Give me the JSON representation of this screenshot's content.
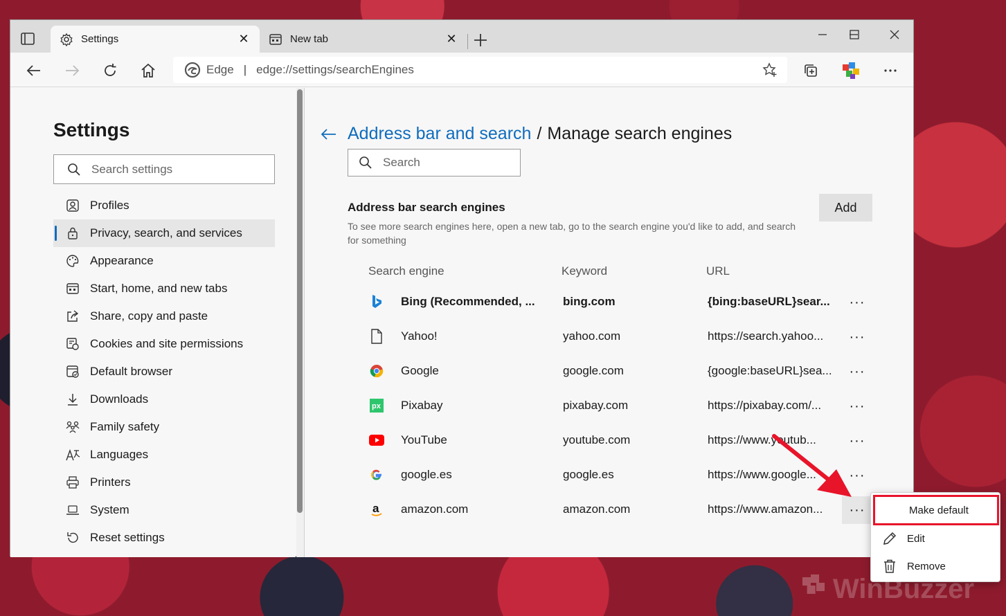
{
  "browser": {
    "tabs": [
      {
        "title": "Settings",
        "icon": "gear-icon"
      },
      {
        "title": "New tab",
        "icon": "newtab-icon"
      }
    ],
    "address": {
      "origin": "Edge",
      "separator": "|",
      "url": "edge://settings/searchEngines"
    }
  },
  "sidebar": {
    "title": "Settings",
    "search_placeholder": "Search settings",
    "items": [
      {
        "label": "Profiles",
        "icon": "profile-icon"
      },
      {
        "label": "Privacy, search, and services",
        "icon": "lock-icon",
        "selected": true
      },
      {
        "label": "Appearance",
        "icon": "palette-icon"
      },
      {
        "label": "Start, home, and new tabs",
        "icon": "start-icon"
      },
      {
        "label": "Share, copy and paste",
        "icon": "share-icon"
      },
      {
        "label": "Cookies and site permissions",
        "icon": "cookies-icon"
      },
      {
        "label": "Default browser",
        "icon": "browser-icon"
      },
      {
        "label": "Downloads",
        "icon": "download-icon"
      },
      {
        "label": "Family safety",
        "icon": "family-icon"
      },
      {
        "label": "Languages",
        "icon": "languages-icon"
      },
      {
        "label": "Printers",
        "icon": "printer-icon"
      },
      {
        "label": "System",
        "icon": "laptop-icon"
      },
      {
        "label": "Reset settings",
        "icon": "reset-icon"
      }
    ]
  },
  "main": {
    "breadcrumb_link": "Address bar and search",
    "breadcrumb_sep": "/",
    "breadcrumb_current": "Manage search engines",
    "search_placeholder": "Search",
    "section_title": "Address bar search engines",
    "section_desc": "To see more search engines here, open a new tab, go to the search engine you'd like to add, and search for something",
    "add_label": "Add",
    "columns": {
      "engine": "Search engine",
      "keyword": "Keyword",
      "url": "URL"
    },
    "engines": [
      {
        "name": "Bing (Recommended, ...",
        "keyword": "bing.com",
        "url": "{bing:baseURL}sear...",
        "icon": "bing-icon",
        "default": true
      },
      {
        "name": "Yahoo!",
        "keyword": "yahoo.com",
        "url": "https://search.yahoo...",
        "icon": "page-icon"
      },
      {
        "name": "Google",
        "keyword": "google.com",
        "url": "{google:baseURL}sea...",
        "icon": "chrome-icon"
      },
      {
        "name": "Pixabay",
        "keyword": "pixabay.com",
        "url": "https://pixabay.com/...",
        "icon": "pixabay-icon"
      },
      {
        "name": "YouTube",
        "keyword": "youtube.com",
        "url": "https://www.youtub...",
        "icon": "youtube-icon"
      },
      {
        "name": "google.es",
        "keyword": "google.es",
        "url": "https://www.google...",
        "icon": "google-icon"
      },
      {
        "name": "amazon.com",
        "keyword": "amazon.com",
        "url": "https://www.amazon...",
        "icon": "amazon-icon"
      }
    ],
    "more_label": "···"
  },
  "context_menu": {
    "items": [
      {
        "label": "Make default",
        "icon": ""
      },
      {
        "label": "Edit",
        "icon": "pencil-icon"
      },
      {
        "label": "Remove",
        "icon": "trash-icon"
      }
    ]
  },
  "watermark": "WinBuzzer",
  "colors": {
    "accent": "#0f6cbd",
    "highlight": "#e8142a"
  }
}
